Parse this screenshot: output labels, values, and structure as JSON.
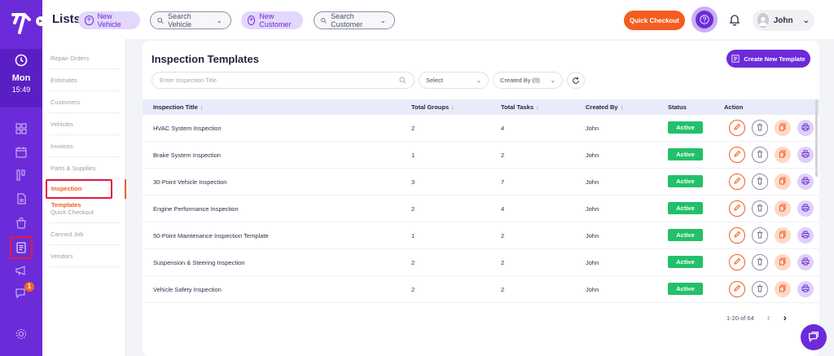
{
  "header": {
    "title": "Lists",
    "new_vehicle": "New Vehicle",
    "search_vehicle": "Search Vehicle",
    "new_customer": "New Customer",
    "search_customer": "Search Customer",
    "quick_checkout": "Quick Checkout",
    "user_name": "John"
  },
  "rail": {
    "day": "Mon",
    "time": "15:49",
    "chat_badge": "1",
    "icons": [
      "grid-icon",
      "calendar-icon",
      "board-icon",
      "document-icon",
      "bag-icon",
      "list-icon",
      "megaphone-icon",
      "chat-icon",
      "settings-icon"
    ]
  },
  "submenu": {
    "items": [
      "Repair Orders",
      "Estimates",
      "Customers",
      "Vehicles",
      "Invoices",
      "Parts & Supplies",
      "Inspection Templates",
      "Quick Checkout",
      "Canned Job",
      "Vendors"
    ],
    "active": "Inspection Templates"
  },
  "main": {
    "title": "Inspection Templates",
    "create_button": "Create New Template",
    "search_placeholder": "Enter Inspection Title",
    "select_label": "Select",
    "created_by_filter": "Created By (0)",
    "columns": [
      "Inspection Title",
      "Total Groups",
      "Total Tasks",
      "Created By",
      "Status",
      "Action"
    ],
    "rows": [
      {
        "title": "HVAC System Inspection",
        "groups": "2",
        "tasks": "4",
        "created_by": "John",
        "status": "Active"
      },
      {
        "title": "Brake System Inspection",
        "groups": "1",
        "tasks": "2",
        "created_by": "John",
        "status": "Active"
      },
      {
        "title": "30-Point Vehicle Inspection",
        "groups": "3",
        "tasks": "7",
        "created_by": "John",
        "status": "Active"
      },
      {
        "title": "Engine Performance Inspection",
        "groups": "2",
        "tasks": "4",
        "created_by": "John",
        "status": "Active"
      },
      {
        "title": "50-Point Maintenance Inspection Template",
        "groups": "1",
        "tasks": "2",
        "created_by": "John",
        "status": "Active"
      },
      {
        "title": "Suspension & Steering Inspection",
        "groups": "2",
        "tasks": "2",
        "created_by": "John",
        "status": "Active"
      },
      {
        "title": "Vehicle Safety Inspection",
        "groups": "2",
        "tasks": "2",
        "created_by": "John",
        "status": "Active"
      }
    ],
    "pagination": "1-20 of 64"
  },
  "colors": {
    "brand": "#6c2bd9",
    "accent": "#f35d1f",
    "active_status": "#22c06a",
    "highlight": "#e21b3c"
  }
}
